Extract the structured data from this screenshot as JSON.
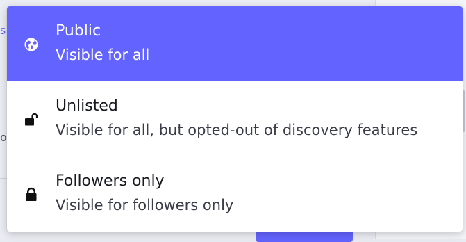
{
  "background": {
    "accent_color": "#6364ff",
    "fragment_top": "s",
    "fragment_mid": "o"
  },
  "privacy_menu": {
    "options": [
      {
        "title": "Public",
        "description": "Visible for all",
        "icon": "globe-icon",
        "selected": true
      },
      {
        "title": "Unlisted",
        "description": "Visible for all, but opted-out of discovery features",
        "icon": "unlock-icon",
        "selected": false
      },
      {
        "title": "Followers only",
        "description": "Visible for followers only",
        "icon": "lock-icon",
        "selected": false
      }
    ],
    "selected_color": "#6364ff"
  }
}
